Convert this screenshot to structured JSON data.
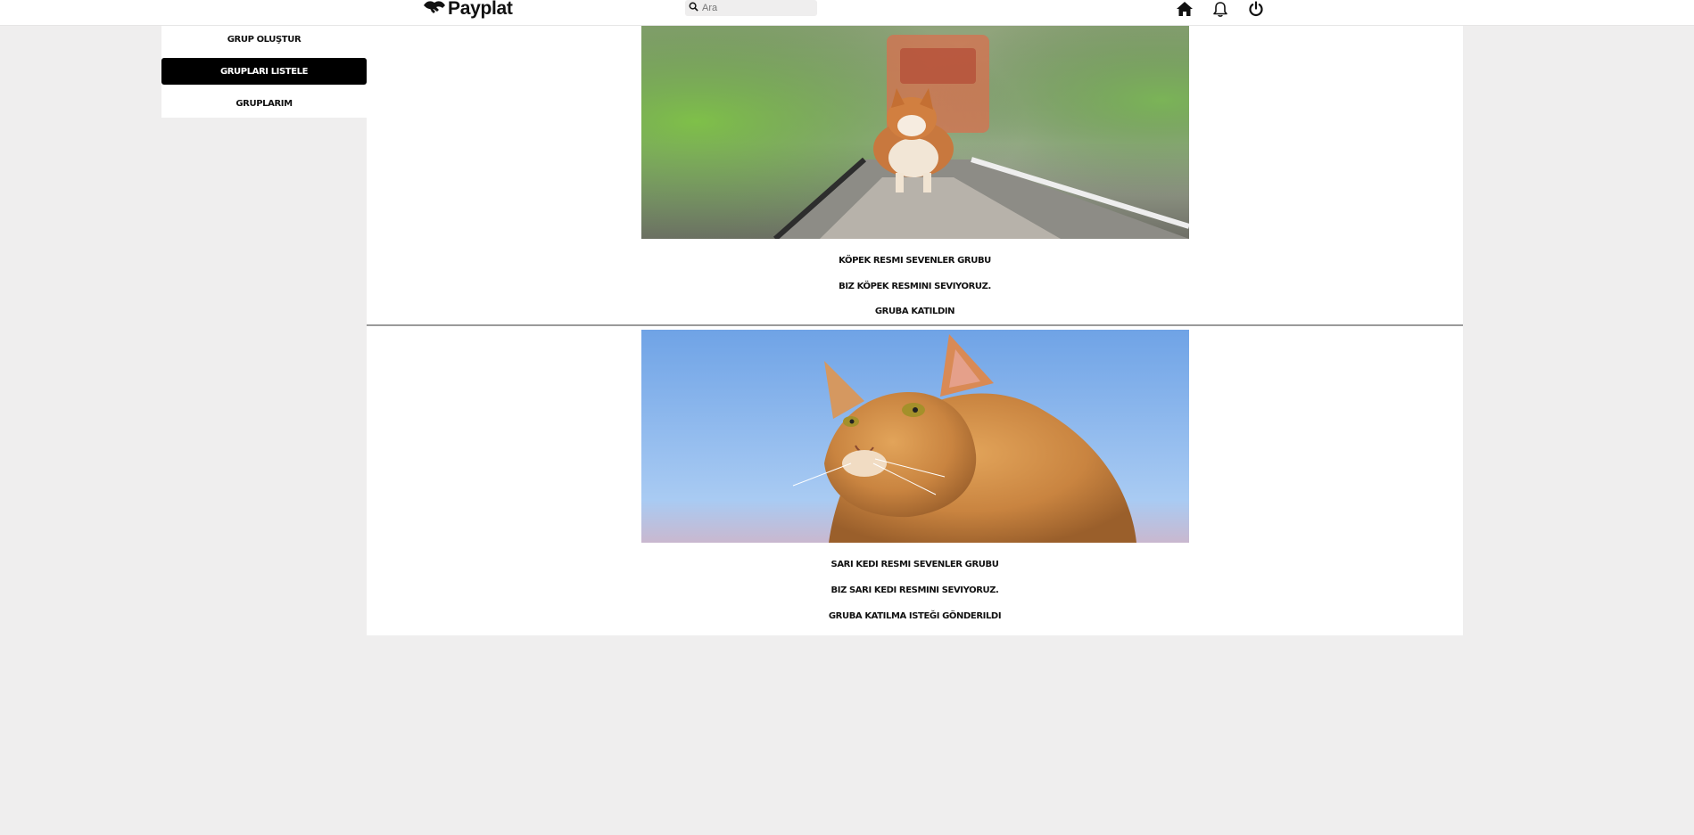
{
  "header": {
    "brand": "Payplat",
    "search_placeholder": "Ara",
    "icons": [
      "handshake-logo-icon",
      "search-icon",
      "home-icon",
      "bell-icon",
      "power-icon"
    ]
  },
  "sidebar": {
    "items": [
      {
        "label": "GRUP OLUŞTUR",
        "active": false
      },
      {
        "label": "GRUPLARI LISTELE",
        "active": true
      },
      {
        "label": "GRUPLARIM",
        "active": false
      }
    ]
  },
  "groups": [
    {
      "image": "corgi-on-railway-image",
      "title": "KÖPEK RESMI SEVENLER GRUBU",
      "description": "BIZ KÖPEK RESMINI SEVIYORUZ.",
      "status": "GRUBA KATILDIN"
    },
    {
      "image": "orange-cat-sky-image",
      "title": "SARI KEDI RESMI SEVENLER GRUBU",
      "description": "BIZ SARI KEDI RESMINI SEVIYORUZ.",
      "status": "GRUBA KATILMA ISTEĞI GÖNDERILDI"
    }
  ],
  "colors": {
    "background": "#efeeee",
    "panel": "#ffffff",
    "active_button": "#000000",
    "text": "#111111"
  }
}
